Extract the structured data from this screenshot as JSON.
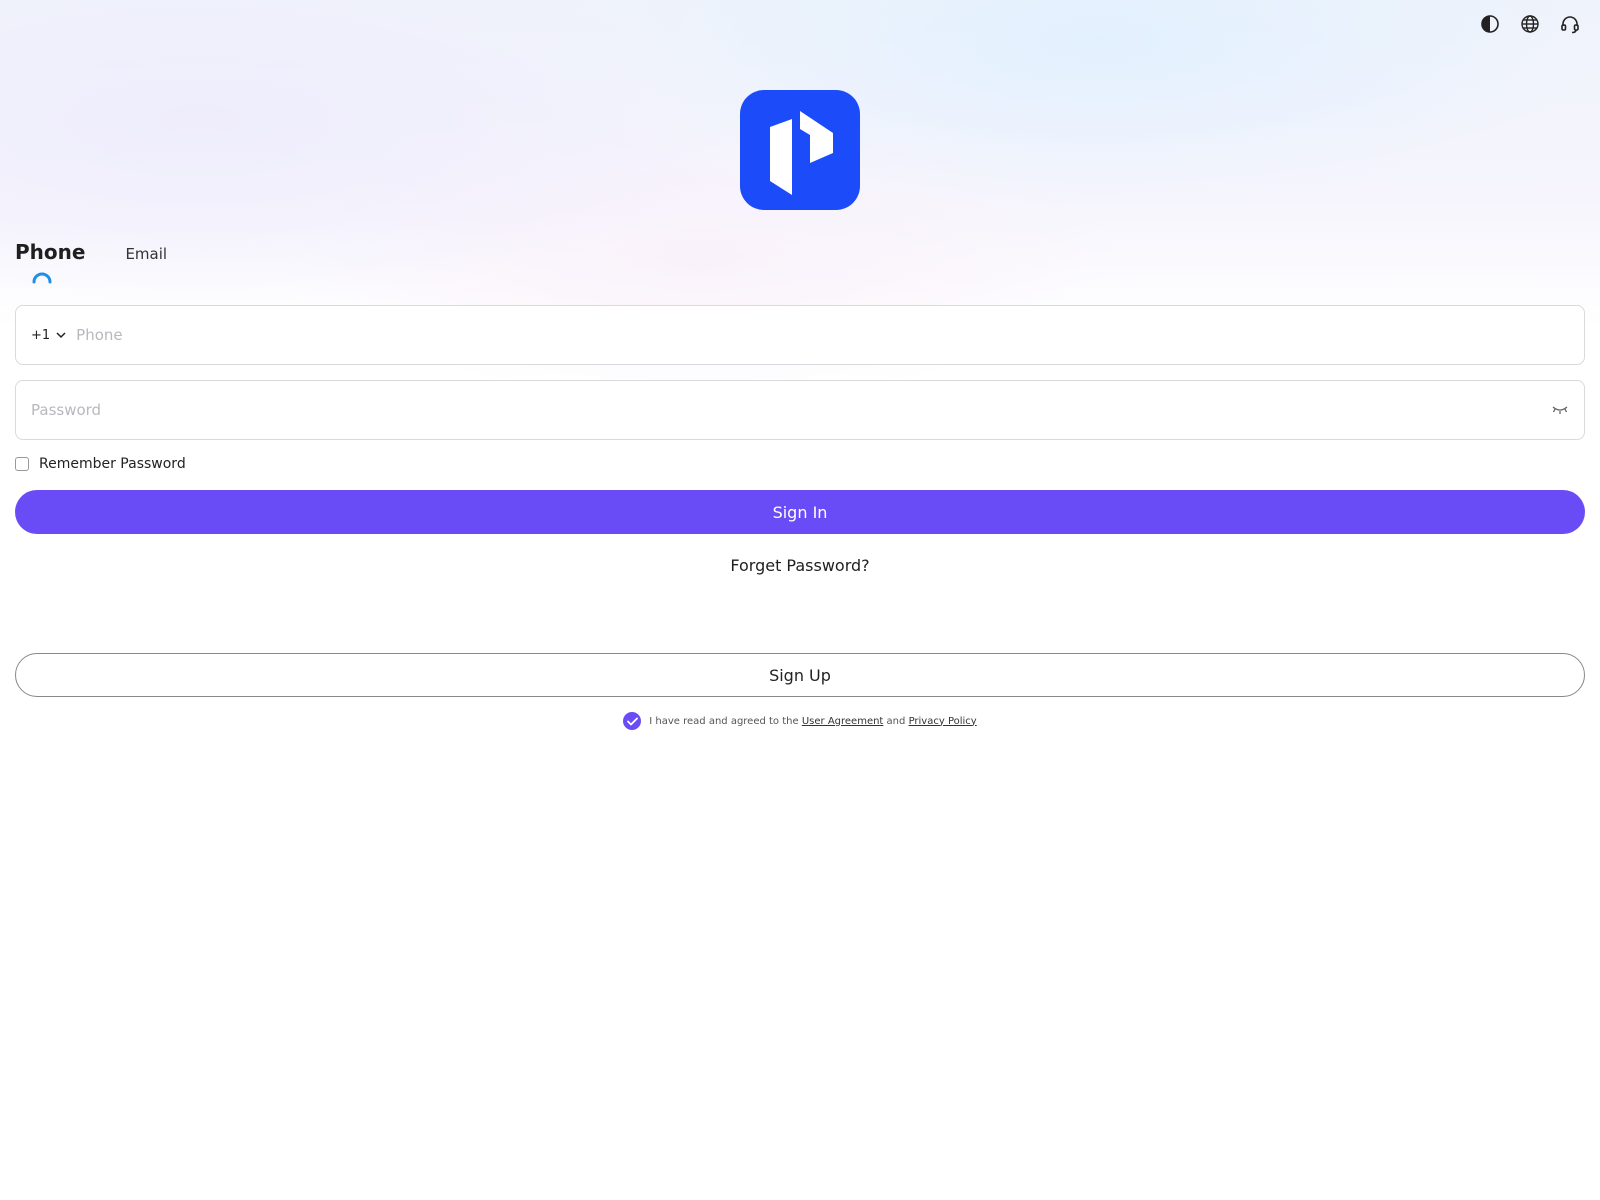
{
  "header": {
    "icons": [
      "contrast-icon",
      "globe-icon",
      "headset-icon"
    ]
  },
  "logo": {
    "name": "app-logo",
    "color": "#1c4bfa"
  },
  "tabs": [
    {
      "label": "Phone",
      "active": true
    },
    {
      "label": "Email",
      "active": false
    }
  ],
  "phone_field": {
    "country_code": "+1",
    "placeholder": "Phone",
    "value": ""
  },
  "password_field": {
    "placeholder": "Password",
    "value": ""
  },
  "remember": {
    "label": "Remember Password",
    "checked": false
  },
  "signin_button": {
    "label": "Sign In",
    "color": "#6a4cf7"
  },
  "forget_password": {
    "label": "Forget Password?"
  },
  "signup_button": {
    "label": "Sign Up"
  },
  "agreement": {
    "checked": true,
    "prefix": "I have read and agreed to the",
    "user_agreement": "User Agreement",
    "conjunction": "and",
    "privacy_policy": "Privacy Policy"
  }
}
